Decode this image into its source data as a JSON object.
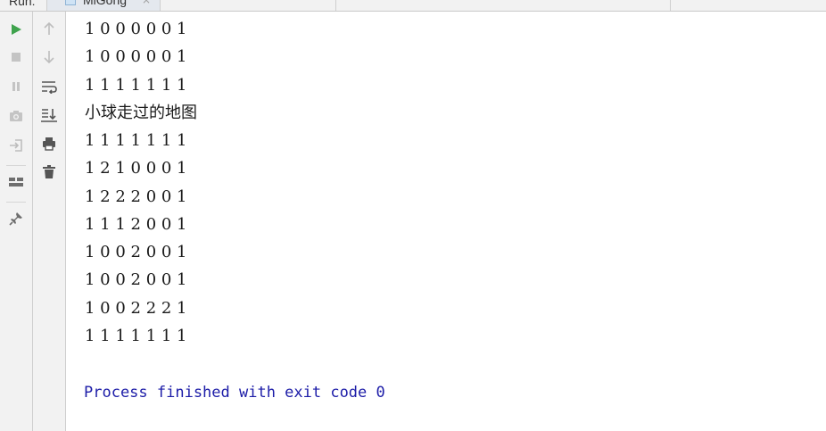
{
  "tabbar": {
    "run_label": "Run:",
    "tab_label": "MiGong",
    "close_glyph": "×"
  },
  "toolbar_left": [
    {
      "name": "rerun-icon",
      "color": "#3fa34d"
    },
    {
      "name": "stop-icon",
      "color": "#b5b5b5"
    },
    {
      "name": "pause-icon",
      "color": "#b5b5b5"
    },
    {
      "name": "camera-icon",
      "color": "#b5b5b5"
    },
    {
      "name": "login-icon",
      "color": "#b5b5b5"
    },
    {
      "name": "layout-icon",
      "color": "#6e6e6e"
    },
    {
      "name": "pin-icon",
      "color": "#6e6e6e"
    }
  ],
  "toolbar_right": [
    {
      "name": "arrow-up-icon"
    },
    {
      "name": "arrow-down-icon"
    },
    {
      "name": "soft-wrap-icon"
    },
    {
      "name": "scroll-to-end-icon"
    },
    {
      "name": "print-icon"
    },
    {
      "name": "trash-icon"
    }
  ],
  "console": {
    "lines": [
      "1 0 0 0 0 0 1",
      "1 0 0 0 0 0 1",
      "1 1 1 1 1 1 1",
      "小球走过的地图",
      "1 1 1 1 1 1 1",
      "1 2 1 0 0 0 1",
      "1 2 2 2 0 0 1",
      "1 1 1 2 0 0 1",
      "1 0 0 2 0 0 1",
      "1 0 0 2 0 0 1",
      "1 0 0 2 2 2 1",
      "1 1 1 1 1 1 1"
    ],
    "exit_message": "Process finished with exit code 0"
  }
}
